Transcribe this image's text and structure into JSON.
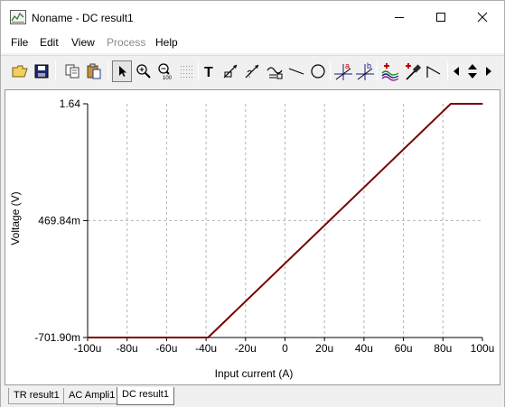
{
  "window": {
    "title": "Noname - DC result1",
    "controls": {
      "minimize": "minimize",
      "maximize": "maximize",
      "close": "close"
    }
  },
  "menu": {
    "items": [
      {
        "label": "File",
        "enabled": true
      },
      {
        "label": "Edit",
        "enabled": true
      },
      {
        "label": "View",
        "enabled": true
      },
      {
        "label": "Process",
        "enabled": false
      },
      {
        "label": "Help",
        "enabled": true
      }
    ]
  },
  "toolbar": {
    "buttons": [
      {
        "icon": "open-folder-icon",
        "pressed": false
      },
      {
        "icon": "save-icon",
        "pressed": false
      },
      {
        "icon": "copy-icon",
        "pressed": false
      },
      {
        "icon": "paste-icon",
        "pressed": false
      },
      {
        "icon": "pointer-arrow-icon",
        "pressed": true
      },
      {
        "icon": "zoom-in-icon",
        "pressed": false
      },
      {
        "icon": "zoom-100-icon",
        "pressed": false
      },
      {
        "icon": "grid-dots-icon",
        "pressed": false
      },
      {
        "icon": "text-tool-icon",
        "pressed": false
      },
      {
        "icon": "comment-arrow-icon",
        "pressed": false
      },
      {
        "icon": "comment-question-icon",
        "pressed": false
      },
      {
        "icon": "line-label-icon",
        "pressed": false
      },
      {
        "icon": "line-icon",
        "pressed": false
      },
      {
        "icon": "circle-icon",
        "pressed": false
      },
      {
        "icon": "cursor-a-icon",
        "pressed": false
      },
      {
        "icon": "cursor-b-icon",
        "pressed": false
      },
      {
        "icon": "add-curve-icon",
        "pressed": false
      },
      {
        "icon": "probe-icon",
        "pressed": false
      },
      {
        "icon": "slope-icon",
        "pressed": false
      },
      {
        "icon": "scroll-left-icon",
        "pressed": false
      },
      {
        "icon": "scroll-updown-icon",
        "pressed": false
      },
      {
        "icon": "scroll-right-icon",
        "pressed": false
      }
    ],
    "text_tool_glyph": "T",
    "cursor_a_glyph": "a",
    "cursor_b_glyph": "b",
    "zoom_100_glyph": "100"
  },
  "chart_data": {
    "type": "line",
    "xlabel": "Input current (A)",
    "ylabel": "Voltage (V)",
    "x_ticks": [
      "-100u",
      "-80u",
      "-60u",
      "-40u",
      "-20u",
      "0",
      "20u",
      "40u",
      "60u",
      "80u",
      "100u"
    ],
    "y_ticks": [
      "1.64",
      "469.84m",
      "-701.90m"
    ],
    "xlim": [
      -100,
      100
    ],
    "x_unit_scale": "u",
    "ylim": [
      -0.7019,
      1.64
    ],
    "y_tick_values": [
      1.64,
      0.46984,
      -0.7019
    ],
    "grid": true,
    "series": [
      {
        "color": "#7a0000",
        "x": [
          -100,
          -39,
          84,
          100
        ],
        "y": [
          -0.7019,
          -0.7019,
          1.64,
          1.64
        ]
      }
    ]
  },
  "tabs": [
    {
      "label": "TR result1",
      "active": false
    },
    {
      "label": "AC Ampli1",
      "active": false
    },
    {
      "label": "DC result1",
      "active": true
    }
  ],
  "colors": {
    "trace": "#7a0000",
    "grid": "#b4b4b4",
    "axis": "#000000"
  }
}
